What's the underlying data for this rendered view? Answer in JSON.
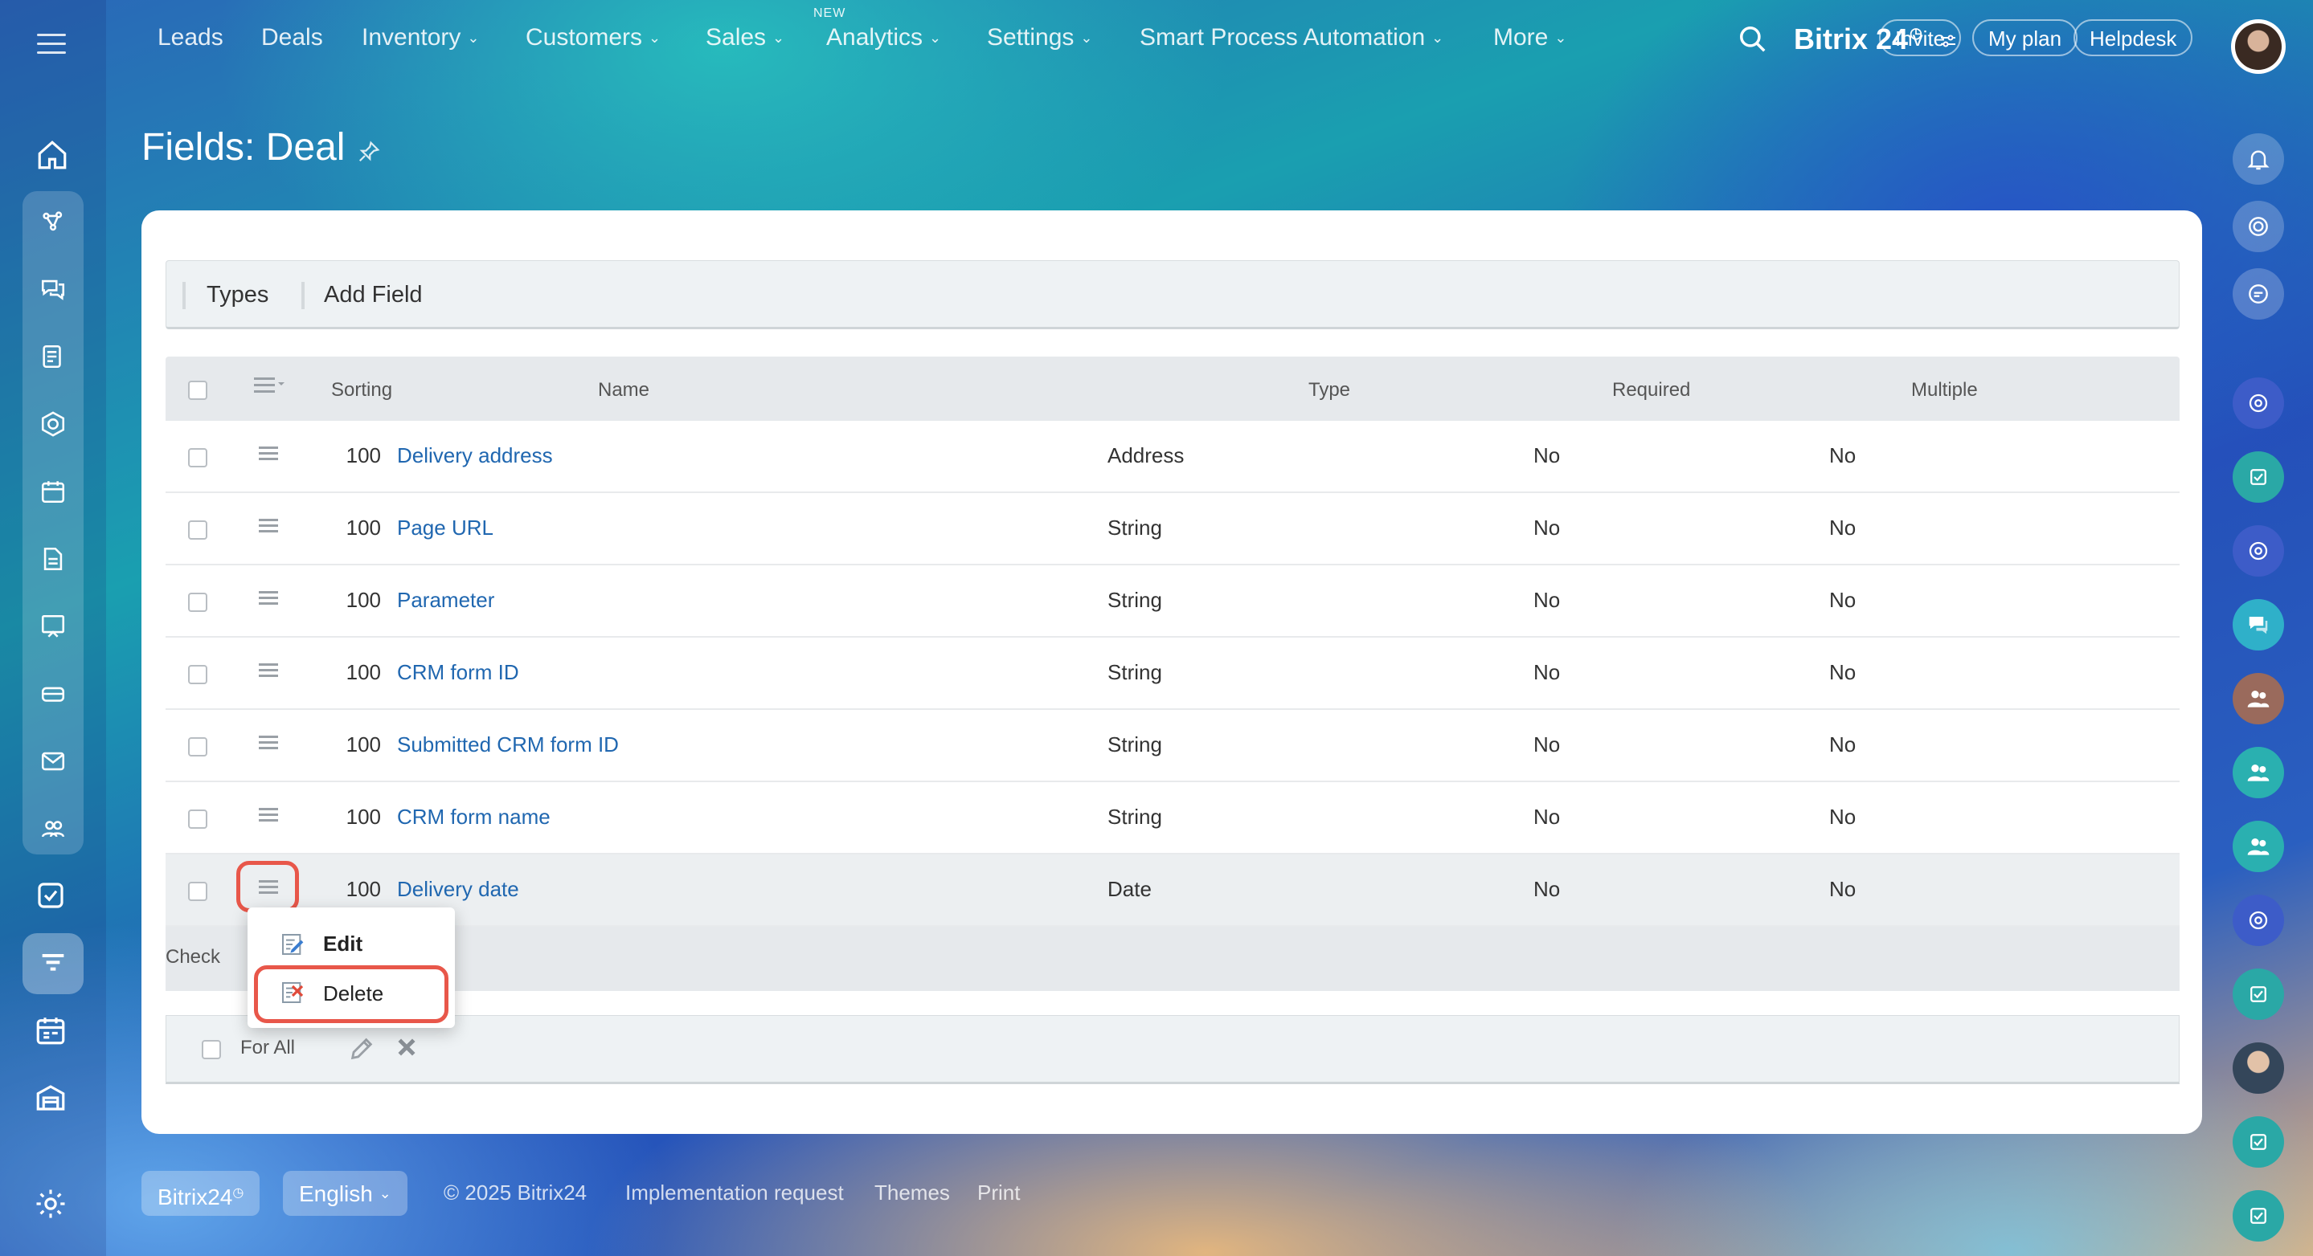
{
  "topnav": {
    "items": [
      {
        "label": "Leads",
        "chevron": false
      },
      {
        "label": "Deals",
        "chevron": false
      },
      {
        "label": "Inventory",
        "chevron": true
      },
      {
        "label": "Customers",
        "chevron": true
      },
      {
        "label": "Sales",
        "chevron": true
      },
      {
        "label": "Analytics",
        "chevron": true
      },
      {
        "label": "Settings",
        "chevron": true
      },
      {
        "label": "Smart Process Automation",
        "chevron": true
      },
      {
        "label": "More",
        "chevron": true
      }
    ],
    "new_badge": "NEW",
    "brand": "Bitrix 24",
    "invite": "Invite",
    "my_plan": "My plan",
    "helpdesk": "Helpdesk"
  },
  "page": {
    "title": "Fields: Deal"
  },
  "toolbar": {
    "types": "Types",
    "add_field": "Add Field"
  },
  "grid": {
    "headers": {
      "sorting": "Sorting",
      "name": "Name",
      "type": "Type",
      "required": "Required",
      "multiple": "Multiple"
    },
    "rows": [
      {
        "sorting": "100",
        "name": "Delivery address",
        "type": "Address",
        "required": "No",
        "multiple": "No"
      },
      {
        "sorting": "100",
        "name": "Page URL",
        "type": "String",
        "required": "No",
        "multiple": "No"
      },
      {
        "sorting": "100",
        "name": "Parameter",
        "type": "String",
        "required": "No",
        "multiple": "No"
      },
      {
        "sorting": "100",
        "name": "CRM form ID",
        "type": "String",
        "required": "No",
        "multiple": "No"
      },
      {
        "sorting": "100",
        "name": "Submitted CRM form ID",
        "type": "String",
        "required": "No",
        "multiple": "No"
      },
      {
        "sorting": "100",
        "name": "CRM form name",
        "type": "String",
        "required": "No",
        "multiple": "No"
      },
      {
        "sorting": "100",
        "name": "Delivery date",
        "type": "Date",
        "required": "No",
        "multiple": "No"
      }
    ],
    "check_label": "Check",
    "for_all": "For All"
  },
  "context_menu": {
    "edit": "Edit",
    "delete": "Delete"
  },
  "footer": {
    "brand": "Bitrix24",
    "language": "English",
    "copyright": "© 2025 Bitrix24",
    "implementation": "Implementation request",
    "themes": "Themes",
    "print": "Print"
  },
  "colors": {
    "accent_link": "#2067b0",
    "highlight": "#e8574a"
  }
}
